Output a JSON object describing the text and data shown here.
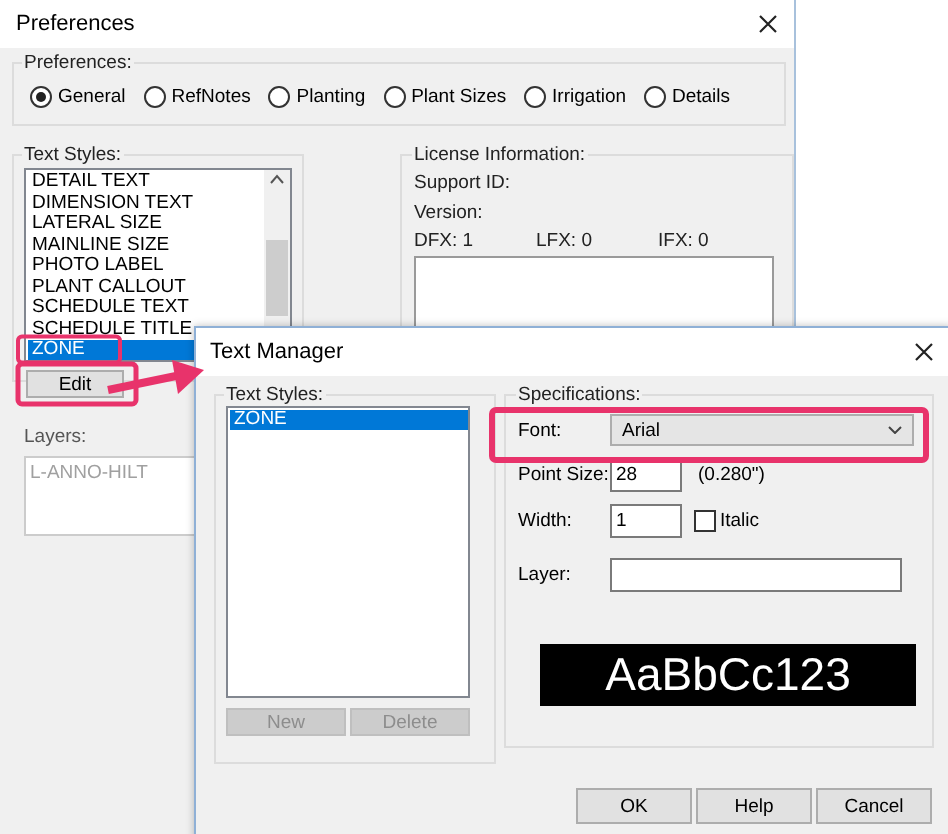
{
  "preferences_window": {
    "title": "Preferences"
  },
  "preferences_group": {
    "label": "Preferences:",
    "options": [
      {
        "label": "General",
        "selected": true
      },
      {
        "label": "RefNotes",
        "selected": false
      },
      {
        "label": "Planting",
        "selected": false
      },
      {
        "label": "Plant Sizes",
        "selected": false
      },
      {
        "label": "Irrigation",
        "selected": false
      },
      {
        "label": "Details",
        "selected": false
      }
    ]
  },
  "text_styles": {
    "label": "Text Styles:",
    "items": [
      {
        "label": "DETAIL TEXT",
        "selected": false
      },
      {
        "label": "DIMENSION TEXT",
        "selected": false
      },
      {
        "label": "LATERAL SIZE",
        "selected": false
      },
      {
        "label": "MAINLINE SIZE",
        "selected": false
      },
      {
        "label": "PHOTO LABEL",
        "selected": false
      },
      {
        "label": "PLANT CALLOUT",
        "selected": false
      },
      {
        "label": "SCHEDULE TEXT",
        "selected": false
      },
      {
        "label": "SCHEDULE TITLE",
        "selected": false
      },
      {
        "label": "ZONE",
        "selected": true
      }
    ],
    "edit_button": "Edit"
  },
  "layers": {
    "label": "Layers:",
    "disabled": true,
    "items": [
      "L-ANNO-HILT"
    ]
  },
  "license": {
    "label": "License Information:",
    "support_id": "Support ID:",
    "version": "Version:",
    "counts": [
      "DFX: 1",
      "LFX: 0",
      "IFX: 0"
    ]
  },
  "text_manager": {
    "title": "Text Manager",
    "styles_label": "Text Styles:",
    "styles": [
      {
        "label": "ZONE",
        "selected": true
      }
    ],
    "buttons": [
      {
        "label": "New",
        "disabled": true
      },
      {
        "label": "Delete",
        "disabled": true
      }
    ],
    "spec_label": "Specifications:",
    "font": {
      "label": "Font:",
      "value": "Arial"
    },
    "point_size": {
      "label": "Point Size:",
      "value": "28",
      "note": "(0.280\")"
    },
    "width": {
      "label": "Width:",
      "value": "1"
    },
    "italic": {
      "label": "Italic",
      "checked": false
    },
    "layer": {
      "label": "Layer:"
    },
    "preview": "AaBbCc123",
    "actions": [
      "OK",
      "Help",
      "Cancel"
    ]
  }
}
